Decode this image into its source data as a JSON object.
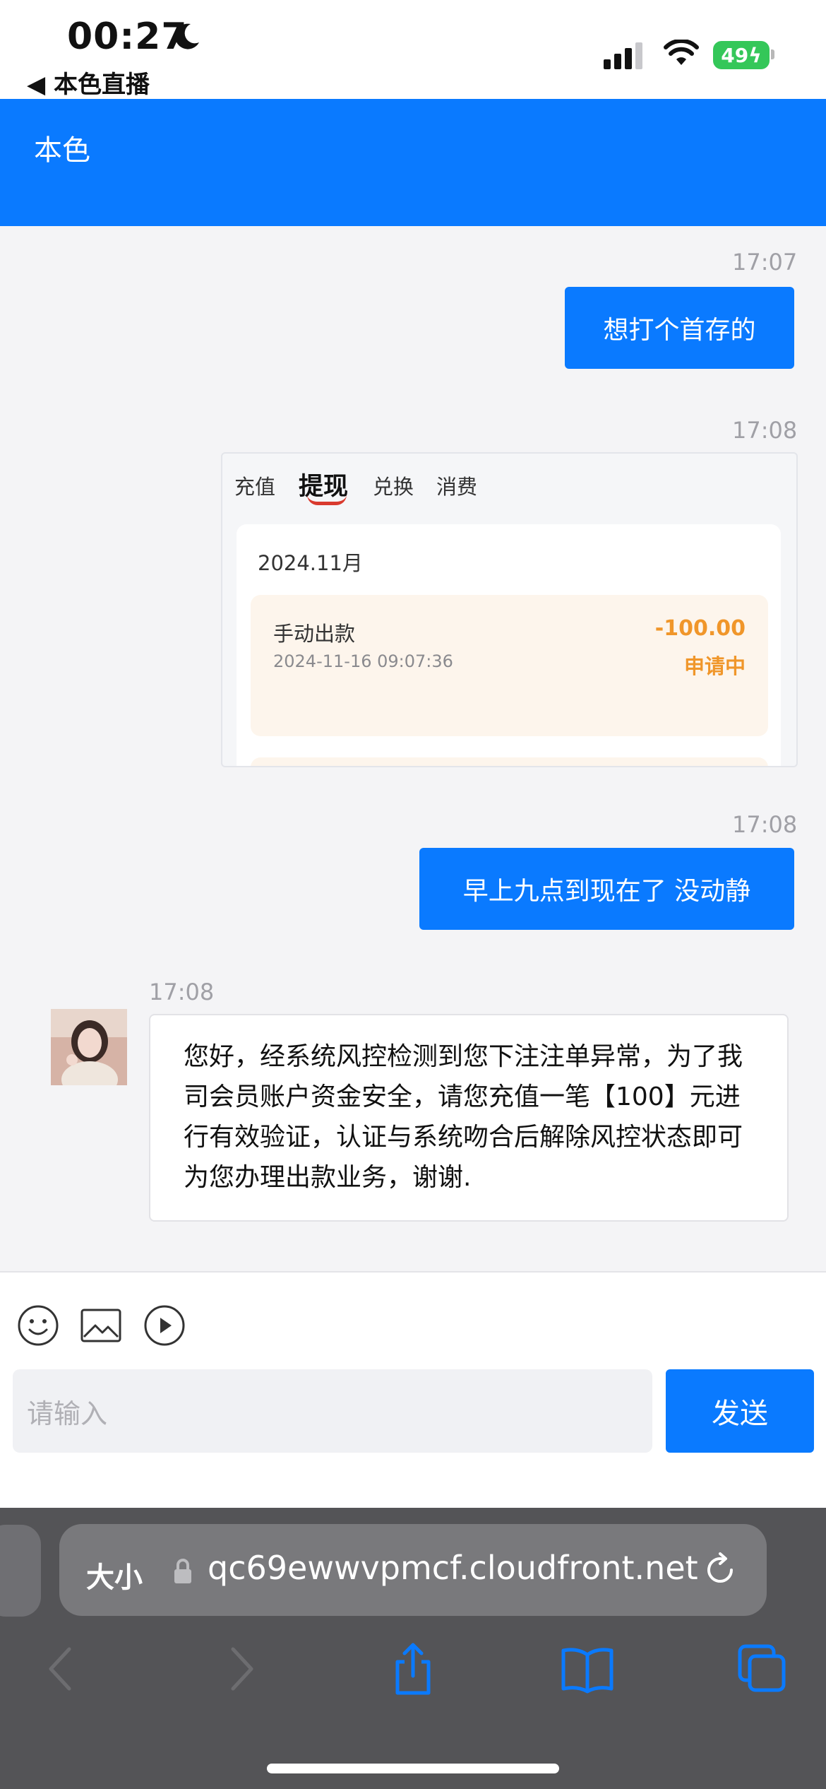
{
  "status_bar": {
    "time": "00:27",
    "back_app": "◀ 本色直播",
    "battery": "49"
  },
  "header": {
    "title": "本色"
  },
  "messages": [
    {
      "time": "17:07",
      "text": "想打个首存的"
    },
    {
      "time": "17:08"
    },
    {
      "time": "17:08",
      "text": "早上九点到现在了 没动静"
    },
    {
      "time": "17:08",
      "text": "您好，经系统风控检测到您下注注单异常，为了我司会员账户资金安全，请您充值一笔【100】元进行有效验证，认证与系统吻合后解除风控状态即可为您办理出款业务，谢谢."
    }
  ],
  "screenshot_card": {
    "tabs": [
      "充值",
      "提现",
      "兑换",
      "消费"
    ],
    "month": "2024.11月",
    "order": {
      "title": "手动出款",
      "datetime": "2024-11-16 09:07:36",
      "amount": "-100.00",
      "status": "申请中"
    }
  },
  "composer": {
    "placeholder": "请输入",
    "send_label": "发送"
  },
  "browser": {
    "text_size_label": "大小",
    "url": "qc69ewwvpmcf.cloudfront.net"
  },
  "colors": {
    "accent": "#0a7aff",
    "battery": "#34c759",
    "order_amount": "#f0962a"
  }
}
